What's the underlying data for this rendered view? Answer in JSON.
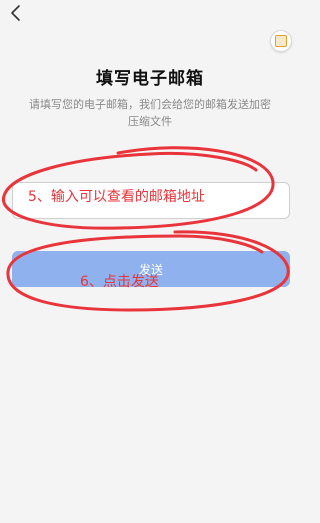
{
  "header": {
    "back_icon": "chevron-left-icon",
    "corner_icon": "app-badge-icon"
  },
  "main": {
    "title": "填写电子邮箱",
    "subtitle": "请填写您的电子邮箱，我们会给您的邮箱发送加密压缩文件",
    "email_placeholder": "",
    "send_label": "发送"
  },
  "annotations": {
    "step5": "5、输入可以查看的邮箱地址",
    "step6": "6、点击发送",
    "color": "#e8343a"
  },
  "colors": {
    "background": "#f4f4f4",
    "button": "#8fb2ee",
    "annotation": "#e8343a"
  }
}
